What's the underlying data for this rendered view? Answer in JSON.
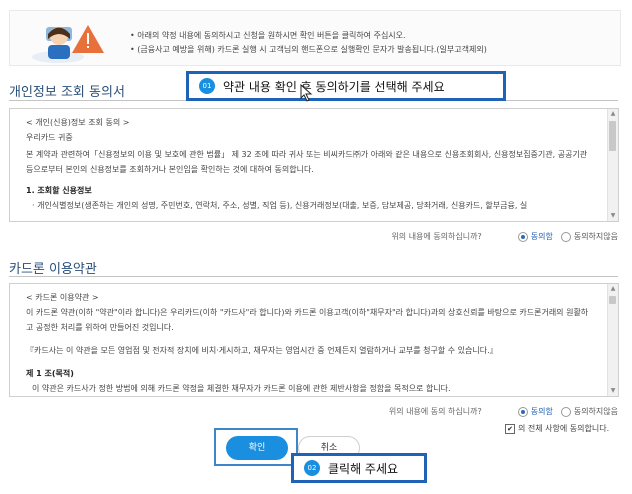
{
  "notice": {
    "line1": "아래의 약정 내용에 동의하시고 신청을 원하시면 확인 버튼을 클릭하여 주십시오.",
    "line2": "(금융사고 예방을 위해) 카드론 실행 시 고객님의 핸드폰으로 실행확인 문자가 발송됩니다.(일부고객제외)"
  },
  "callouts": {
    "c1_num": "01",
    "c1_text": "약관 내용 확인 후 동의하기를 선택해 주세요",
    "c2_num": "02",
    "c2_text": "클릭해 주세요"
  },
  "section1": {
    "title": "개인정보 조회 동의서",
    "doc_heading": "< 개인(신용)정보 조회 동의 >",
    "addressee": "우리카드 귀중",
    "para": "본 계약과 관련하여「신용정보의 이용 및 보호에 관한 법률」 제 32 조에 따라 귀사 또는 비씨카드㈜가 아래와 같은 내용으로 신용조회회사, 신용정보집중기관, 공공기관 등으로부터 본인의 신용정보를 조회하거나 본인임을 확인하는 것에 대하여 동의합니다.",
    "subheading": "1. 조회할 신용정보",
    "bullet": "· 개인식별정보(생존하는 개인의 성명, 주민번호, 연락처, 주소, 성별, 직업 등), 신용거래정보(대출, 보증, 담보제공, 당좌거래, 신용카드, 할부금융, 실",
    "question": "위의 내용에 동의하십니까?",
    "agree": "동의함",
    "disagree": "동의하지않음"
  },
  "section2": {
    "title": "카드론 이용약관",
    "doc_heading": "< 카드론 이용약관 >",
    "para1": "이 카드론 약관(이하 \"약관\"이라 합니다)은 우리카드(이하 \"카드사\"라 합니다)와 카드론 이용고객(이하\"채무자\"라 합니다)과의 상호신뢰를 바탕으로 카드론거래의 원활하고 공정한 처리를 위하여 만들어진 것입니다.",
    "para2": "『카드사는 이 약관을 모든 영업점 및 전자적 장치에 비치·게시하고, 채무자는 영업시간 중 언제든지 열람하거나 교부를 청구할 수 있습니다.』",
    "subheading": "제 1 조(목적)",
    "line_cut": "이 약관은 카드사가 정한 방법에 의해 카드론 약정을 체결한 채무자가 카드론 이용에 관한 제반사항을 정함을 목적으로 합니다.",
    "question": "위의 내용에 동의 하십니까?",
    "agree": "동의함",
    "disagree": "동의하지않음"
  },
  "all_agree": "의 전체 사항에 동의합니다.",
  "all_agree_mark": "✔",
  "buttons": {
    "confirm": "확인",
    "cancel": "취소"
  }
}
